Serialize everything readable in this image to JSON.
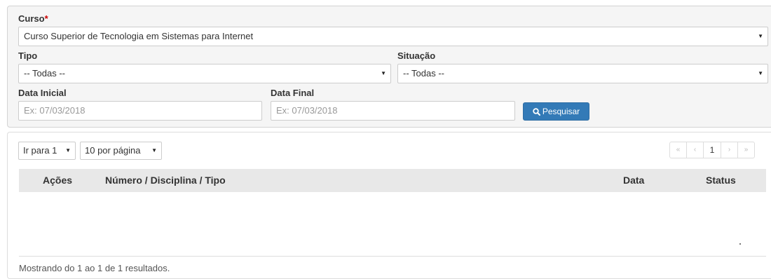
{
  "filters": {
    "curso": {
      "label": "Curso",
      "required_mark": "*",
      "selected": "Curso Superior de Tecnologia em Sistemas para Internet"
    },
    "tipo": {
      "label": "Tipo",
      "selected": "-- Todas --"
    },
    "situacao": {
      "label": "Situação",
      "selected": "-- Todas --"
    },
    "data_inicial": {
      "label": "Data Inicial",
      "placeholder": "Ex: 07/03/2018"
    },
    "data_final": {
      "label": "Data Final",
      "placeholder": "Ex: 07/03/2018"
    },
    "search_button": {
      "label": "Pesquisar",
      "icon": "search-icon",
      "color": "#337ab7"
    }
  },
  "results": {
    "goto_select": "Ir para 1",
    "per_page_select": "10 por página",
    "pagination": {
      "first": "«",
      "prev": "‹",
      "current": "1",
      "next": "›",
      "last": "»"
    },
    "columns": [
      "Ações",
      "Número / Disciplina / Tipo",
      "Data",
      "Status"
    ],
    "footer": "Mostrando do 1 ao 1 de 1 resultados."
  }
}
